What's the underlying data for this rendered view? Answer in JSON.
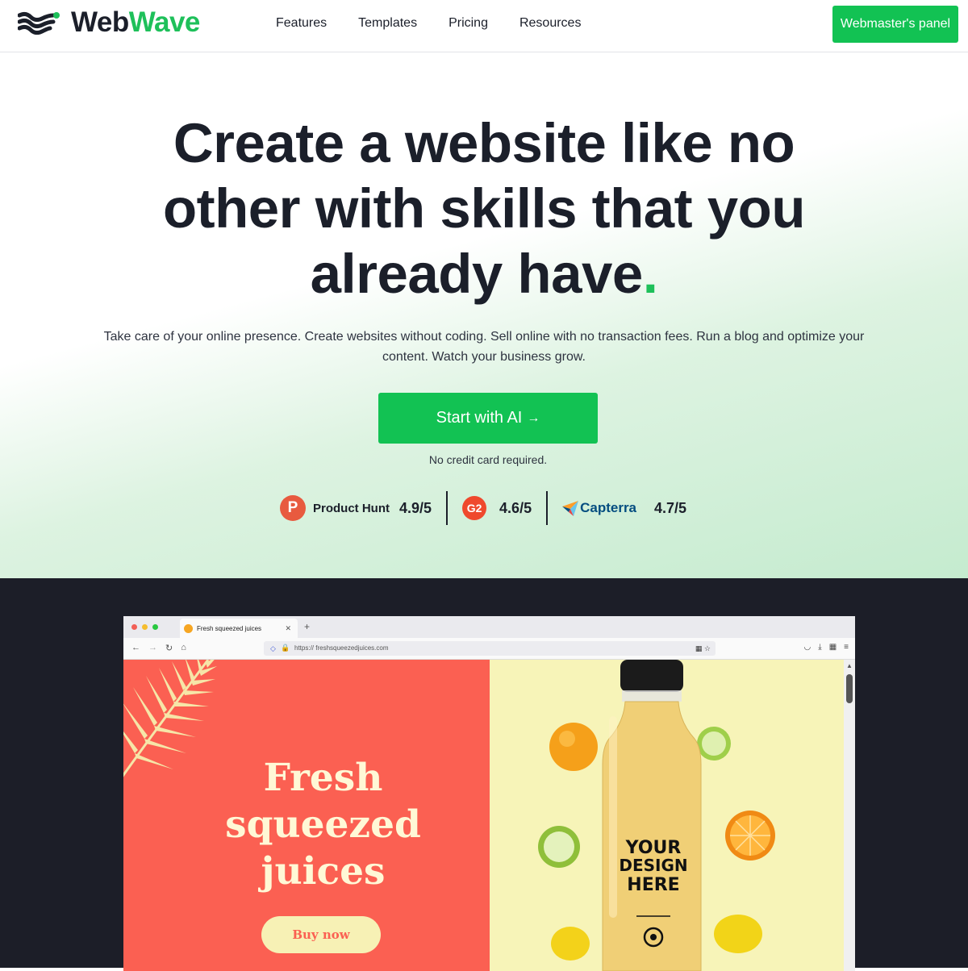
{
  "brand": {
    "word1": "Web",
    "word2": "Wave"
  },
  "nav": [
    "Features",
    "Templates",
    "Pricing",
    "Resources"
  ],
  "header_cta": "Webmaster's panel",
  "hero": {
    "title": "Create a website like no other with skills that you already have",
    "title_dot": ".",
    "subtitle": "Take care of your online presence. Create websites without coding. Sell online with no transaction fees. Run a blog and optimize your content. Watch your business grow.",
    "cta": "Start with AI",
    "cta_arrow": "→",
    "note": "No credit card required."
  },
  "ratings": [
    {
      "name": "Product Hunt",
      "icon_letter": "P",
      "score": "4.9/5"
    },
    {
      "name": "G2",
      "icon_letter": "G2",
      "score": "4.6/5"
    },
    {
      "name": "Capterra",
      "score": "4.7/5"
    }
  ],
  "browser": {
    "tab_title": "Fresh squeezed juices",
    "url": "https:// freshsqueezedjuices.com"
  },
  "preview": {
    "title": "Fresh squeezed juices",
    "button": "Buy now",
    "bottle_label": [
      "YOUR",
      "DESIGN",
      "HERE"
    ]
  },
  "colors": {
    "accent": "#12c253",
    "dark": "#1c1e28",
    "coral": "#fb6052",
    "cream": "#f7f4b8"
  }
}
